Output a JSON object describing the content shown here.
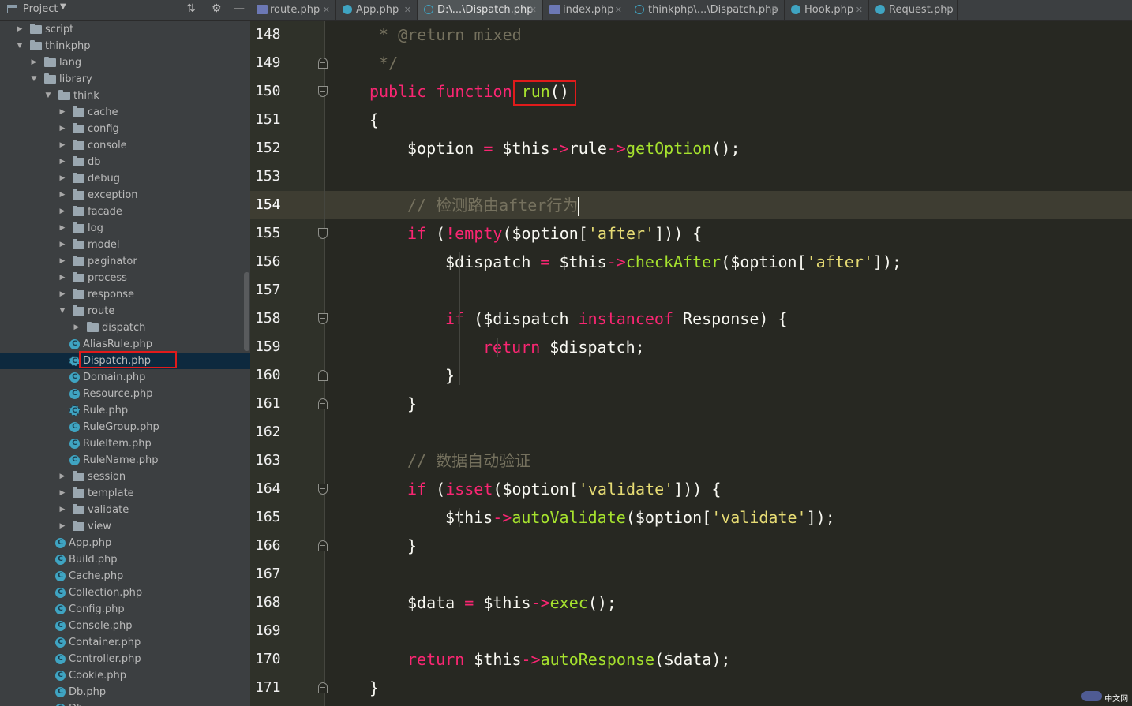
{
  "project_panel": {
    "title": "Project",
    "tree": [
      {
        "label": "script",
        "type": "folder",
        "depth": 0,
        "expanded": false
      },
      {
        "label": "thinkphp",
        "type": "folder",
        "depth": 0,
        "expanded": true
      },
      {
        "label": "lang",
        "type": "folder",
        "depth": 1,
        "expanded": false
      },
      {
        "label": "library",
        "type": "folder",
        "depth": 1,
        "expanded": true
      },
      {
        "label": "think",
        "type": "folder",
        "depth": 2,
        "expanded": true
      },
      {
        "label": "cache",
        "type": "folder",
        "depth": 3,
        "expanded": false
      },
      {
        "label": "config",
        "type": "folder",
        "depth": 3,
        "expanded": false
      },
      {
        "label": "console",
        "type": "folder",
        "depth": 3,
        "expanded": false
      },
      {
        "label": "db",
        "type": "folder",
        "depth": 3,
        "expanded": false
      },
      {
        "label": "debug",
        "type": "folder",
        "depth": 3,
        "expanded": false
      },
      {
        "label": "exception",
        "type": "folder",
        "depth": 3,
        "expanded": false
      },
      {
        "label": "facade",
        "type": "folder",
        "depth": 3,
        "expanded": false
      },
      {
        "label": "log",
        "type": "folder",
        "depth": 3,
        "expanded": false
      },
      {
        "label": "model",
        "type": "folder",
        "depth": 3,
        "expanded": false
      },
      {
        "label": "paginator",
        "type": "folder",
        "depth": 3,
        "expanded": false
      },
      {
        "label": "process",
        "type": "folder",
        "depth": 3,
        "expanded": false
      },
      {
        "label": "response",
        "type": "folder",
        "depth": 3,
        "expanded": false
      },
      {
        "label": "route",
        "type": "folder",
        "depth": 3,
        "expanded": true
      },
      {
        "label": "dispatch",
        "type": "folder",
        "depth": 4,
        "expanded": false
      },
      {
        "label": "AliasRule.php",
        "type": "class",
        "depth": 4
      },
      {
        "label": "Dispatch.php",
        "type": "abstract",
        "depth": 4,
        "selected": true
      },
      {
        "label": "Domain.php",
        "type": "class",
        "depth": 4
      },
      {
        "label": "Resource.php",
        "type": "class",
        "depth": 4
      },
      {
        "label": "Rule.php",
        "type": "abstract",
        "depth": 4
      },
      {
        "label": "RuleGroup.php",
        "type": "class",
        "depth": 4
      },
      {
        "label": "RuleItem.php",
        "type": "class",
        "depth": 4
      },
      {
        "label": "RuleName.php",
        "type": "class",
        "depth": 4
      },
      {
        "label": "session",
        "type": "folder",
        "depth": 3,
        "expanded": false
      },
      {
        "label": "template",
        "type": "folder",
        "depth": 3,
        "expanded": false
      },
      {
        "label": "validate",
        "type": "folder",
        "depth": 3,
        "expanded": false
      },
      {
        "label": "view",
        "type": "folder",
        "depth": 3,
        "expanded": false
      },
      {
        "label": "App.php",
        "type": "class",
        "depth": 3
      },
      {
        "label": "Build.php",
        "type": "class",
        "depth": 3
      },
      {
        "label": "Cache.php",
        "type": "class",
        "depth": 3
      },
      {
        "label": "Collection.php",
        "type": "class",
        "depth": 3
      },
      {
        "label": "Config.php",
        "type": "class",
        "depth": 3
      },
      {
        "label": "Console.php",
        "type": "class",
        "depth": 3
      },
      {
        "label": "Container.php",
        "type": "class",
        "depth": 3
      },
      {
        "label": "Controller.php",
        "type": "class",
        "depth": 3
      },
      {
        "label": "Cookie.php",
        "type": "class",
        "depth": 3
      },
      {
        "label": "Db.php",
        "type": "class",
        "depth": 3
      },
      {
        "label": "Db...",
        "type": "class",
        "depth": 3
      }
    ]
  },
  "tabs": [
    {
      "label": "route.php",
      "icon": "php-file-icon",
      "active": false
    },
    {
      "label": "App.php",
      "icon": "class-icon",
      "active": false
    },
    {
      "label": "D:\\...\\Dispatch.php",
      "icon": "abstract-class-icon",
      "active": true
    },
    {
      "label": "index.php",
      "icon": "php-file-icon",
      "active": false
    },
    {
      "label": "thinkphp\\...\\Dispatch.php",
      "icon": "abstract-class-icon",
      "active": false
    },
    {
      "label": "Hook.php",
      "icon": "class-icon",
      "active": false
    },
    {
      "label": "Request.php",
      "icon": "class-icon",
      "active": false
    }
  ],
  "editor": {
    "current_line": 154,
    "lines": [
      {
        "n": 148,
        "indent": 1,
        "tokens": [
          [
            "cm",
            " * @return mixed"
          ]
        ]
      },
      {
        "n": 149,
        "indent": 1,
        "fold": "close",
        "tokens": [
          [
            "cm",
            " */"
          ]
        ]
      },
      {
        "n": 150,
        "indent": 1,
        "fold": "open",
        "tokens": [
          [
            "kw",
            "public"
          ],
          [
            "pl",
            " "
          ],
          [
            "kw",
            "function"
          ],
          [
            "pl",
            " "
          ],
          [
            "fn",
            "run"
          ],
          [
            "pl",
            "()"
          ]
        ]
      },
      {
        "n": 151,
        "indent": 1,
        "tokens": [
          [
            "pl",
            "{"
          ]
        ]
      },
      {
        "n": 152,
        "indent": 2,
        "tokens": [
          [
            "pl",
            "$option "
          ],
          [
            "op",
            "="
          ],
          [
            "pl",
            " $this"
          ],
          [
            "op",
            "->"
          ],
          [
            "pl",
            "rule"
          ],
          [
            "op",
            "->"
          ],
          [
            "fn",
            "getOption"
          ],
          [
            "pl",
            "();"
          ]
        ]
      },
      {
        "n": 153,
        "indent": 2,
        "tokens": []
      },
      {
        "n": 154,
        "indent": 2,
        "tokens": [
          [
            "cm",
            "// 检测路由after行为"
          ]
        ],
        "caret": true
      },
      {
        "n": 155,
        "indent": 2,
        "fold": "open",
        "tokens": [
          [
            "kw",
            "if"
          ],
          [
            "pl",
            " ("
          ],
          [
            "op",
            "!"
          ],
          [
            "kw",
            "empty"
          ],
          [
            "pl",
            "($option["
          ],
          [
            "str",
            "'after'"
          ],
          [
            "pl",
            "])) {"
          ]
        ]
      },
      {
        "n": 156,
        "indent": 3,
        "tokens": [
          [
            "pl",
            "$dispatch "
          ],
          [
            "op",
            "="
          ],
          [
            "pl",
            " $this"
          ],
          [
            "op",
            "->"
          ],
          [
            "fn",
            "checkAfter"
          ],
          [
            "pl",
            "($option["
          ],
          [
            "str",
            "'after'"
          ],
          [
            "pl",
            "]);"
          ]
        ]
      },
      {
        "n": 157,
        "indent": 3,
        "tokens": []
      },
      {
        "n": 158,
        "indent": 3,
        "fold": "open",
        "tokens": [
          [
            "kw",
            "if"
          ],
          [
            "pl",
            " ($dispatch "
          ],
          [
            "kw",
            "instanceof"
          ],
          [
            "pl",
            " Response) {"
          ]
        ]
      },
      {
        "n": 159,
        "indent": 4,
        "tokens": [
          [
            "kw",
            "return"
          ],
          [
            "pl",
            " $dispatch;"
          ]
        ]
      },
      {
        "n": 160,
        "indent": 3,
        "fold": "close",
        "tokens": [
          [
            "pl",
            "}"
          ]
        ]
      },
      {
        "n": 161,
        "indent": 2,
        "fold": "close",
        "tokens": [
          [
            "pl",
            "}"
          ]
        ]
      },
      {
        "n": 162,
        "indent": 2,
        "tokens": []
      },
      {
        "n": 163,
        "indent": 2,
        "tokens": [
          [
            "cm",
            "// 数据自动验证"
          ]
        ]
      },
      {
        "n": 164,
        "indent": 2,
        "fold": "open",
        "tokens": [
          [
            "kw",
            "if"
          ],
          [
            "pl",
            " ("
          ],
          [
            "kw",
            "isset"
          ],
          [
            "pl",
            "($option["
          ],
          [
            "str",
            "'validate'"
          ],
          [
            "pl",
            "])) {"
          ]
        ]
      },
      {
        "n": 165,
        "indent": 3,
        "tokens": [
          [
            "pl",
            "$this"
          ],
          [
            "op",
            "->"
          ],
          [
            "fn",
            "autoValidate"
          ],
          [
            "pl",
            "($option["
          ],
          [
            "str",
            "'validate'"
          ],
          [
            "pl",
            "]);"
          ]
        ]
      },
      {
        "n": 166,
        "indent": 2,
        "fold": "close",
        "tokens": [
          [
            "pl",
            "}"
          ]
        ]
      },
      {
        "n": 167,
        "indent": 2,
        "tokens": []
      },
      {
        "n": 168,
        "indent": 2,
        "tokens": [
          [
            "pl",
            "$data "
          ],
          [
            "op",
            "="
          ],
          [
            "pl",
            " $this"
          ],
          [
            "op",
            "->"
          ],
          [
            "fn",
            "exec"
          ],
          [
            "pl",
            "();"
          ]
        ]
      },
      {
        "n": 169,
        "indent": 2,
        "tokens": []
      },
      {
        "n": 170,
        "indent": 2,
        "tokens": [
          [
            "kw",
            "return"
          ],
          [
            "pl",
            " $this"
          ],
          [
            "op",
            "->"
          ],
          [
            "fn",
            "autoResponse"
          ],
          [
            "pl",
            "($data);"
          ]
        ]
      },
      {
        "n": 171,
        "indent": 1,
        "fold": "close",
        "tokens": [
          [
            "pl",
            "}"
          ]
        ]
      }
    ]
  },
  "watermark": {
    "logo_text": "",
    "site": "中文网"
  },
  "colors": {
    "keyword": "#f92672",
    "function": "#a6e22e",
    "string": "#e6db74",
    "comment": "#75715e",
    "highlight_box": "#e01b1b"
  }
}
